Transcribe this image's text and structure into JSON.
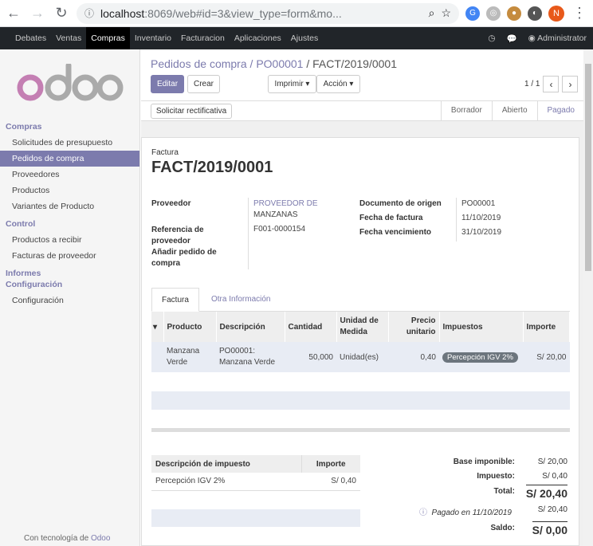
{
  "browser": {
    "url_host": "localhost",
    "url_rest": ":8069/web#id=3&view_type=form&mo...",
    "profile_initial": "N"
  },
  "topmenu": {
    "items": [
      "Debates",
      "Ventas",
      "Compras",
      "Inventario",
      "Facturacion",
      "Aplicaciones",
      "Ajustes"
    ],
    "user": "Administrator"
  },
  "sidebar": {
    "sections": [
      {
        "title": "Compras",
        "items": [
          "Solicitudes de presupuesto",
          "Pedidos de compra",
          "Proveedores",
          "Productos",
          "Variantes de Producto"
        ]
      },
      {
        "title": "Control",
        "items": [
          "Productos a recibir",
          "Facturas de proveedor"
        ]
      },
      {
        "title": "Informes",
        "items": []
      },
      {
        "title": "Configuración",
        "items": [
          "Configuración"
        ]
      }
    ],
    "footer_prefix": "Con tecnología de",
    "footer_brand": "Odoo"
  },
  "breadcrumb": {
    "a": "Pedidos de compra",
    "sep1": "/",
    "b": "PO00001",
    "sep2": "/",
    "current": "FACT/2019/0001"
  },
  "buttons": {
    "edit": "Editar",
    "create": "Crear",
    "print": "Imprimir ▾",
    "action": "Acción ▾",
    "rectify": "Solicitar rectificativa"
  },
  "pager": {
    "text": "1 / 1"
  },
  "stages": [
    "Borrador",
    "Abierto",
    "Pagado"
  ],
  "invoice": {
    "kind": "Factura",
    "number": "FACT/2019/0001",
    "labels": {
      "vendor": "Proveedor",
      "ref": "Referencia de proveedor",
      "add_po": "Añadir pedido de compra",
      "origin": "Documento de origen",
      "date": "Fecha de factura",
      "due": "Fecha vencimiento"
    },
    "vendor_line1": "PROVEEDOR DE",
    "vendor_line2": "MANZANAS",
    "ref": "F001-0000154",
    "origin": "PO00001",
    "date": "11/10/2019",
    "due": "31/10/2019"
  },
  "tabs": [
    "Factura",
    "Otra Información"
  ],
  "lines": {
    "headers": {
      "product": "Producto",
      "desc": "Descripción",
      "qty": "Cantidad",
      "uom": "Unidad de Medida",
      "price": "Precio unitario",
      "taxes": "Impuestos",
      "amount": "Importe"
    },
    "rows": [
      {
        "product": "Manzana Verde",
        "desc": "PO00001: Manzana Verde",
        "qty": "50,000",
        "uom": "Unidad(es)",
        "price": "0,40",
        "tax": "Percepción IGV 2%",
        "amount": "S/ 20,00"
      }
    ]
  },
  "taxes": {
    "h_desc": "Descripción de impuesto",
    "h_amount": "Importe",
    "row_desc": "Percepción IGV 2%",
    "row_amount": "S/ 0,40"
  },
  "totals": {
    "base_l": "Base imponible:",
    "base": "S/ 20,00",
    "tax_l": "Impuesto:",
    "tax": "S/ 0,40",
    "total_l": "Total:",
    "total": "S/ 20,40",
    "paid_l": "Pagado en 11/10/2019",
    "paid": "S/ 20,40",
    "due_l": "Saldo:",
    "due": "S/ 0,00"
  }
}
